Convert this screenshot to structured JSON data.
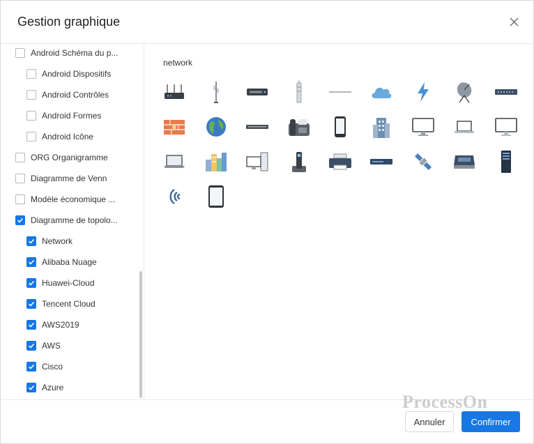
{
  "dialog": {
    "title": "Gestion graphique",
    "close_icon": "close-icon"
  },
  "tree": {
    "items": [
      {
        "label": "Android Schéma du p...",
        "checked": false,
        "level": 0
      },
      {
        "label": "Android Dispositifs",
        "checked": false,
        "level": 1
      },
      {
        "label": "Android Contrôles",
        "checked": false,
        "level": 1
      },
      {
        "label": "Android Formes",
        "checked": false,
        "level": 1
      },
      {
        "label": "Android Icône",
        "checked": false,
        "level": 1
      },
      {
        "label": "ORG Organigramme",
        "checked": false,
        "level": 0
      },
      {
        "label": "Diagramme de Venn",
        "checked": false,
        "level": 0
      },
      {
        "label": "Modèle économique ...",
        "checked": false,
        "level": 0
      },
      {
        "label": "Diagramme de topolo...",
        "checked": true,
        "level": 0
      },
      {
        "label": "Network",
        "checked": true,
        "level": 1
      },
      {
        "label": "Alibaba Nuage",
        "checked": true,
        "level": 1
      },
      {
        "label": "Huawei-Cloud",
        "checked": true,
        "level": 1
      },
      {
        "label": "Tencent Cloud",
        "checked": true,
        "level": 1
      },
      {
        "label": "AWS2019",
        "checked": true,
        "level": 1
      },
      {
        "label": "AWS",
        "checked": true,
        "level": 1
      },
      {
        "label": "Cisco",
        "checked": true,
        "level": 1
      },
      {
        "label": "Azure",
        "checked": true,
        "level": 1
      }
    ]
  },
  "content": {
    "section_title": "network",
    "shapes": [
      {
        "name": "router-icon"
      },
      {
        "name": "antenna-tower-icon"
      },
      {
        "name": "network-switch-icon"
      },
      {
        "name": "radio-tower-icon"
      },
      {
        "name": "cable-icon"
      },
      {
        "name": "cloud-icon"
      },
      {
        "name": "lightning-icon"
      },
      {
        "name": "satellite-dish-icon"
      },
      {
        "name": "patch-panel-icon"
      },
      {
        "name": "firewall-icon"
      },
      {
        "name": "globe-icon"
      },
      {
        "name": "hub-icon"
      },
      {
        "name": "fax-machine-icon"
      },
      {
        "name": "smartphone-icon"
      },
      {
        "name": "office-building-icon"
      },
      {
        "name": "imac-icon"
      },
      {
        "name": "laptop-icon"
      },
      {
        "name": "monitor-icon"
      },
      {
        "name": "notebook-icon"
      },
      {
        "name": "city-buildings-icon"
      },
      {
        "name": "desktop-computer-icon"
      },
      {
        "name": "cordless-phone-icon"
      },
      {
        "name": "printer-icon"
      },
      {
        "name": "rack-server-icon"
      },
      {
        "name": "satellite-icon"
      },
      {
        "name": "scanner-icon"
      },
      {
        "name": "server-tower-icon"
      },
      {
        "name": "wireless-signal-icon"
      },
      {
        "name": "tablet-icon"
      }
    ]
  },
  "footer": {
    "cancel_label": "Annuler",
    "confirm_label": "Confirmer",
    "watermark": "ProcessOn"
  },
  "colors": {
    "accent": "#1677e5",
    "border": "#e8e8e8"
  }
}
